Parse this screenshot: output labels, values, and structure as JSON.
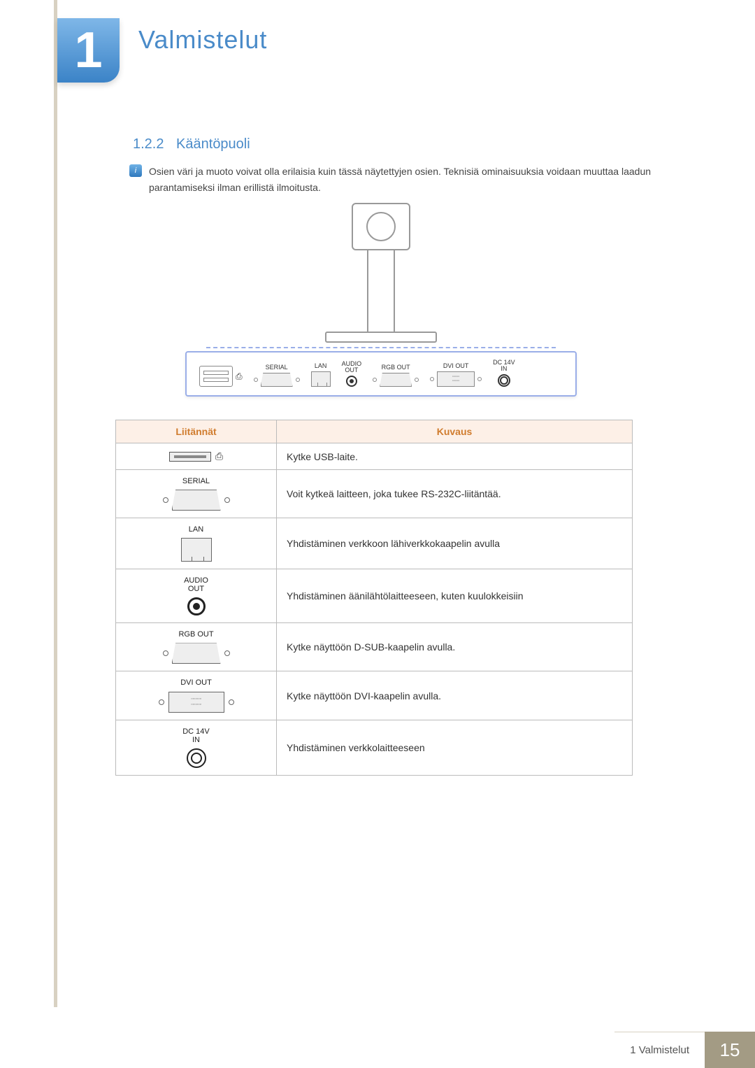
{
  "chapter": {
    "number": "1",
    "title": "Valmistelut"
  },
  "section": {
    "number": "1.2.2",
    "title": "Kääntöpuoli"
  },
  "note": "Osien väri ja muoto voivat olla erilaisia kuin tässä näytettyjen osien. Teknisiä ominaisuuksia voidaan muuttaa laadun parantamiseksi ilman erillistä ilmoitusta.",
  "diagram_ports": {
    "serial": "SERIAL",
    "lan": "LAN",
    "audio": "AUDIO\nOUT",
    "rgb": "RGB OUT",
    "dvi": "DVI OUT",
    "dc": "DC 14V\nIN"
  },
  "table": {
    "headers": {
      "port": "Liitännät",
      "desc": "Kuvaus"
    },
    "rows": [
      {
        "label": "",
        "desc": "Kytke USB-laite."
      },
      {
        "label": "SERIAL",
        "desc": "Voit kytkeä laitteen, joka tukee RS-232C-liitäntää."
      },
      {
        "label": "LAN",
        "desc": "Yhdistäminen verkkoon lähiverkkokaapelin avulla"
      },
      {
        "label": "AUDIO\nOUT",
        "desc": "Yhdistäminen äänilähtölaitteeseen, kuten kuulokkeisiin"
      },
      {
        "label": "RGB OUT",
        "desc": "Kytke näyttöön D-SUB-kaapelin avulla."
      },
      {
        "label": "DVI OUT",
        "desc": "Kytke näyttöön DVI-kaapelin avulla."
      },
      {
        "label": "DC 14V\nIN",
        "desc": "Yhdistäminen verkkolaitteeseen"
      }
    ]
  },
  "footer": {
    "label": "1 Valmistelut",
    "page": "15"
  }
}
